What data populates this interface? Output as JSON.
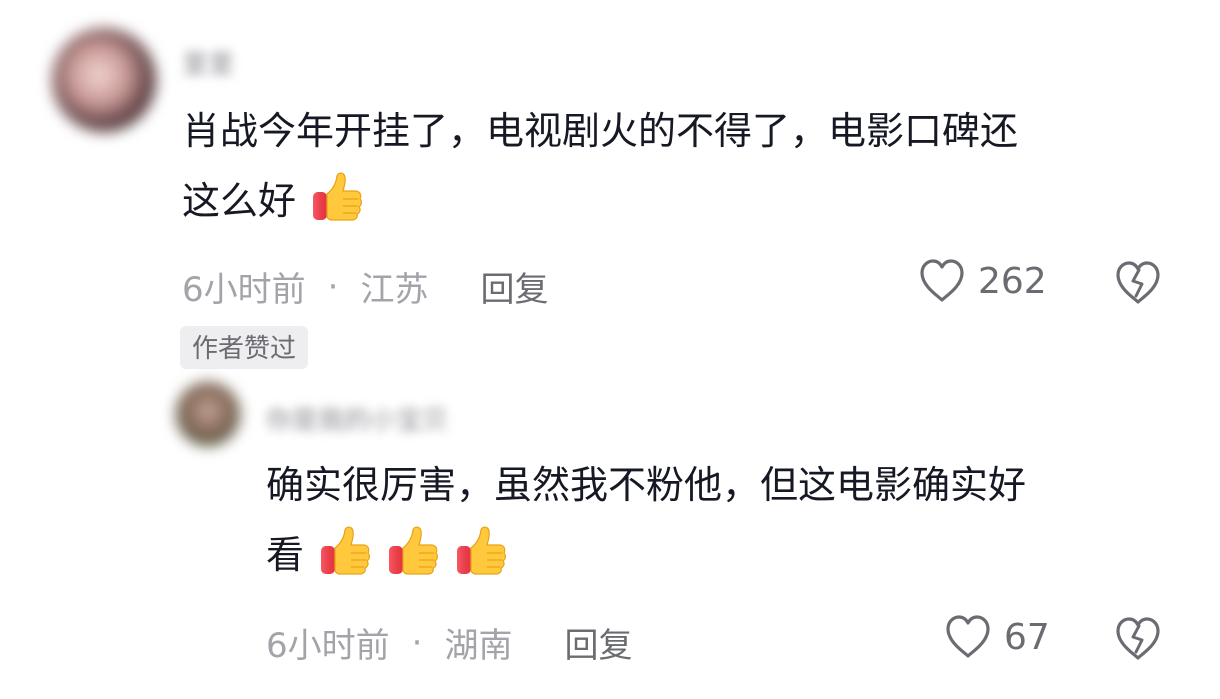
{
  "comments": [
    {
      "username": "里里",
      "text_line1": "肖战今年开挂了，电视剧火的不得了，电影口碑还",
      "text_line2": "这么好",
      "emoji": "thumbs-up-icon",
      "time": "6小时前",
      "separator": "·",
      "location": "江苏",
      "reply_label": "回复",
      "likes": "262",
      "badge": "作者赞过"
    },
    {
      "username": "你是我的小宝贝",
      "text_line1": "确实很厉害，虽然我不粉他，但这电影确实好",
      "text_line2": "看",
      "emoji": "thumbs-up-icon",
      "time": "6小时前",
      "separator": "·",
      "location": "湖南",
      "reply_label": "回复",
      "likes": "67"
    }
  ],
  "colors": {
    "text": "#161823",
    "meta": "#a3a4a9",
    "secondary": "#6b6c72",
    "badge_bg": "#eeeef0",
    "thumb_yellow": "#ffc83d",
    "thumb_red": "#ef3e4a"
  }
}
